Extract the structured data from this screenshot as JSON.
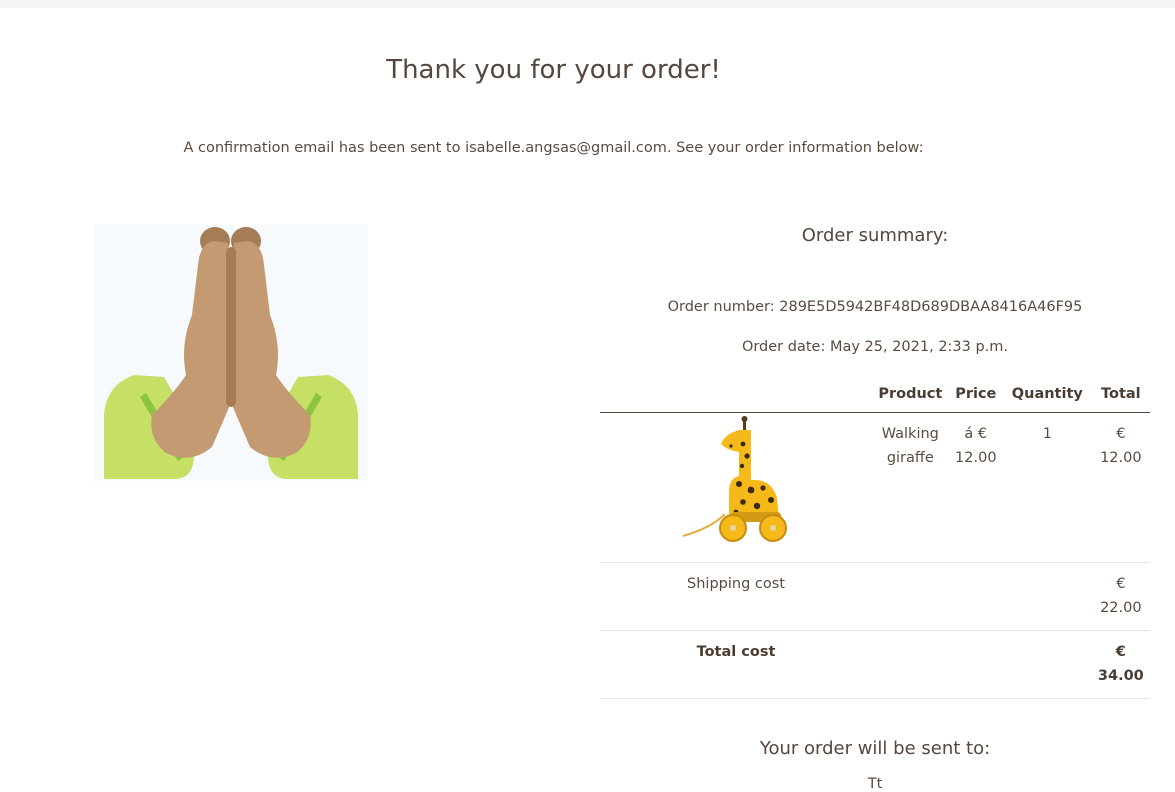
{
  "header": {
    "title": "Thank you for your order!",
    "confirmation_text": "A confirmation email has been sent to isabelle.angsas@gmail.com. See your order information below:"
  },
  "summary": {
    "title": "Order summary:",
    "order_number": "Order number: 289E5D5942BF48D689DBAA8416A46F95",
    "order_date": "Order date: May 25, 2021, 2:33 p.m.",
    "columns": {
      "product": "Product",
      "price": "Price",
      "quantity": "Quantity",
      "total": "Total"
    },
    "items": [
      {
        "image_icon": "giraffe-toy-icon",
        "product": "Walking giraffe",
        "price": "á € 12.00",
        "quantity": "1",
        "total": "€ 12.00"
      }
    ],
    "shipping": {
      "label": "Shipping cost",
      "value": "€ 22.00"
    },
    "grand_total": {
      "label": "Total cost",
      "value": "€ 34.00"
    }
  },
  "shipping_address": {
    "title": "Your order will be sent to:",
    "name_peek": "Tt"
  },
  "illustration": {
    "icon": "praying-hands-icon"
  },
  "colors": {
    "text": "#55473c",
    "sleeve": "#c5e064",
    "skin": "#c49a73",
    "skin_dark": "#a67c57",
    "giraffe": "#f5b919"
  }
}
